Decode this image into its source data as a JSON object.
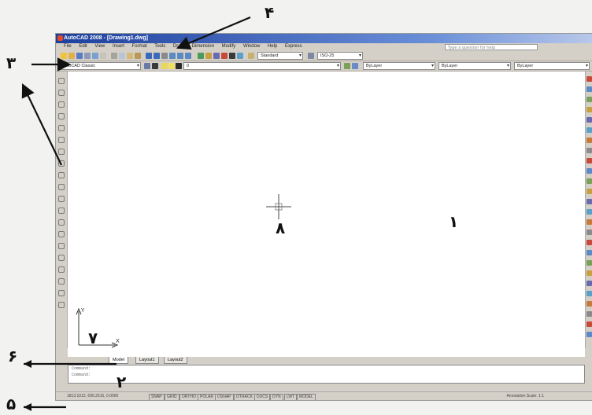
{
  "window": {
    "title": "AutoCAD 2008 - [Drawing1.dwg]",
    "menu_items": [
      "File",
      "Edit",
      "View",
      "Insert",
      "Format",
      "Tools",
      "Draw",
      "Dimension",
      "Modify",
      "Window",
      "Help",
      "Express"
    ],
    "help_placeholder": "Type a question for help"
  },
  "toolbars": {
    "text_style": "Standard",
    "dim_style": "ISO-25",
    "workspace": "AutoCAD Classic",
    "layer": "0",
    "color": "ByLayer",
    "linetype": "ByLayer",
    "lineweight": "ByLayer"
  },
  "layout_tabs": [
    "Model",
    "Layout1",
    "Layout2"
  ],
  "command_lines": [
    "Command:",
    "Command:"
  ],
  "status_bar": {
    "coordinates": "1813.1012, 695.2515, 0.0000",
    "modes": [
      "SNAP",
      "GRID",
      "ORTHO",
      "POLAR",
      "OSNAP",
      "OTRACK",
      "DUCS",
      "DYN",
      "LWT",
      "MODEL"
    ],
    "annotation_scale": "Annotation Scale: 1:1"
  },
  "ucs_labels": {
    "x": "X",
    "y": "Y"
  },
  "callouts": {
    "n1": "۱",
    "n2": "۲",
    "n3": "۳",
    "n4": "۴",
    "n5": "۵",
    "n6": "۶",
    "n7": "۷",
    "n8": "۸"
  },
  "colors": {
    "title_bar": "#1d3f9e",
    "chrome": "#d4d0c8",
    "drawing_area": "#ffffff"
  }
}
